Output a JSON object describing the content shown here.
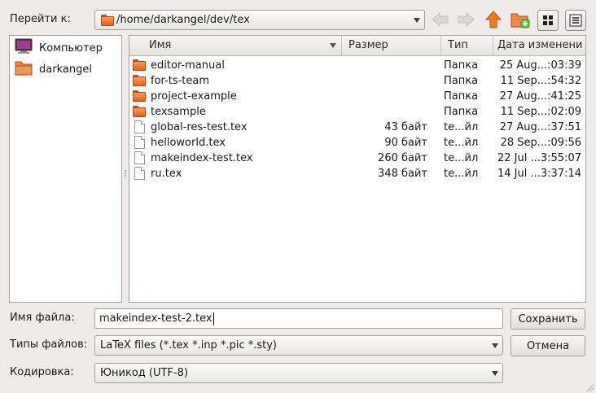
{
  "toolbar": {
    "goto_label": "Перейти к:",
    "path": "/home/darkangel/dev/tex",
    "icons": [
      "back-arrow-icon",
      "forward-arrow-icon",
      "up-arrow-icon",
      "new-folder-icon",
      "icon-view-icon",
      "list-view-icon"
    ]
  },
  "places": [
    {
      "label": "Компьютер",
      "icon": "computer-icon"
    },
    {
      "label": "darkangel",
      "icon": "home-folder-icon"
    }
  ],
  "columns": {
    "name": "Имя",
    "size": "Размер",
    "type": "Тип",
    "date": "Дата изменени"
  },
  "files": [
    {
      "name": "editor-manual",
      "size": "",
      "type": "Папка",
      "date": "25 Aug...:03:39",
      "kind": "folder"
    },
    {
      "name": "for-ts-team",
      "size": "",
      "type": "Папка",
      "date": "11 Sep...:54:32",
      "kind": "folder"
    },
    {
      "name": "project-example",
      "size": "",
      "type": "Папка",
      "date": "27 Aug...:41:25",
      "kind": "folder"
    },
    {
      "name": "texsample",
      "size": "",
      "type": "Папка",
      "date": "11 Sep...:02:09",
      "kind": "folder"
    },
    {
      "name": "global-res-test.tex",
      "size": "43 байт",
      "type": "te...йл",
      "date": "27 Aug...:37:51",
      "kind": "file"
    },
    {
      "name": "helloworld.tex",
      "size": "90 байт",
      "type": "te...йл",
      "date": "28 Sep...:09:56",
      "kind": "file"
    },
    {
      "name": "makeindex-test.tex",
      "size": "260 байт",
      "type": "te...йл",
      "date": "22 Jul ...3:55:07",
      "kind": "file"
    },
    {
      "name": "ru.tex",
      "size": "348 байт",
      "type": "te...йл",
      "date": "14 Jul ...3:37:14",
      "kind": "file"
    }
  ],
  "form": {
    "filename_label": "Имя файла:",
    "filename_value": "makeindex-test-2.tex",
    "filetypes_label": "Типы файлов:",
    "filetypes_value": "LaTeX files (*.tex *.inp *.pic *.sty)",
    "encoding_label": "Кодировка:",
    "encoding_value": "Юникод (UTF-8)",
    "save_label": "Сохранить",
    "cancel_label": "Отмена"
  },
  "colors": {
    "folder": "#e8712c",
    "accent_up": "#f07a1e",
    "background": "#edeceb"
  }
}
